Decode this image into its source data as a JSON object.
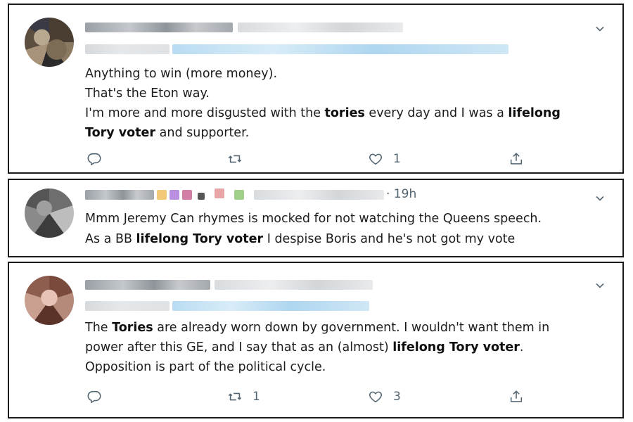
{
  "tweets": [
    {
      "timestamp": "",
      "reply_context": true,
      "body": [
        {
          "t": "Anything to win (more money)."
        },
        {
          "t": "That's the Eton way."
        },
        {
          "t": "I'm more and more disgusted with the ",
          "b": "tories",
          "t2": " every day and I was a ",
          "b2": "lifelong",
          "nl": true
        },
        {
          "t": " ",
          "b": "Tory voter",
          "t2": " and supporter."
        }
      ],
      "actions": {
        "reply": "",
        "retweet": "",
        "like": "1",
        "share": ""
      }
    },
    {
      "timestamp": "· 19h",
      "reply_context": false,
      "body": [
        {
          "t": "Mmm Jeremy Can rhymes is mocked for not watching the Queens speech."
        },
        {
          "t": "As a  BB ",
          "b": "lifelong Tory voter",
          "t2": " I despise Boris and he's not got my vote"
        }
      ],
      "actions": null
    },
    {
      "timestamp": "",
      "reply_context": true,
      "body": [
        {
          "t": "The ",
          "b": "Tories",
          "t2": " are already worn down by government. I wouldn't want them in"
        },
        {
          "t": "power after this GE, and I say that as an (almost) ",
          "b": "lifelong Tory voter",
          "t2": "."
        },
        {
          "t": "Opposition is part of the political cycle."
        }
      ],
      "actions": {
        "reply": "",
        "retweet": "1",
        "like": "3",
        "share": ""
      }
    }
  ],
  "icons": {
    "reply": "reply-icon",
    "retweet": "retweet-icon",
    "like": "heart-icon",
    "share": "share-icon",
    "menu": "chevron-down-icon"
  },
  "colors": {
    "link_blue": "#1da1f2",
    "muted": "#536471",
    "border": "#1a1a1a"
  }
}
